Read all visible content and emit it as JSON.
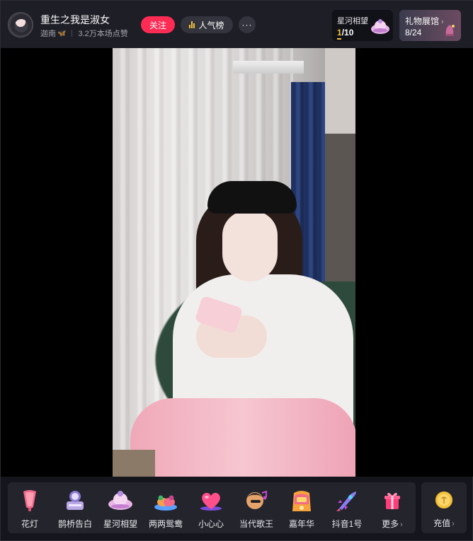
{
  "header": {
    "host_name": "重生之我是淑女",
    "location": "迦南",
    "likes": "3.2万本场点赞",
    "follow_label": "关注",
    "rank_label": "人气榜",
    "more_label": "···",
    "galaxy_card": {
      "title": "星河相望",
      "current": "1",
      "total": "/10"
    },
    "gallery_card": {
      "title": "礼物展馆",
      "count": "8/24"
    }
  },
  "gifts": [
    {
      "label": "花灯",
      "icon": "lantern-icon"
    },
    {
      "label": "鹊桥告白",
      "icon": "magpie-bridge-icon"
    },
    {
      "label": "星河相望",
      "icon": "galaxy-ship-icon"
    },
    {
      "label": "两两鸳鸯",
      "icon": "mandarin-ducks-icon"
    },
    {
      "label": "小心心",
      "icon": "heart-icon"
    },
    {
      "label": "当代歌王",
      "icon": "singer-king-icon"
    },
    {
      "label": "嘉年华",
      "icon": "carnival-icon"
    },
    {
      "label": "抖音1号",
      "icon": "rocket-icon"
    },
    {
      "label": "更多",
      "icon": "gift-box-icon"
    }
  ],
  "recharge": {
    "label": "充值",
    "icon": "coin-icon"
  },
  "colors": {
    "accent": "#fe2c55",
    "gold": "#f5c13a",
    "header_bg": "#1d1e26",
    "bar_bg": "#23242c"
  }
}
